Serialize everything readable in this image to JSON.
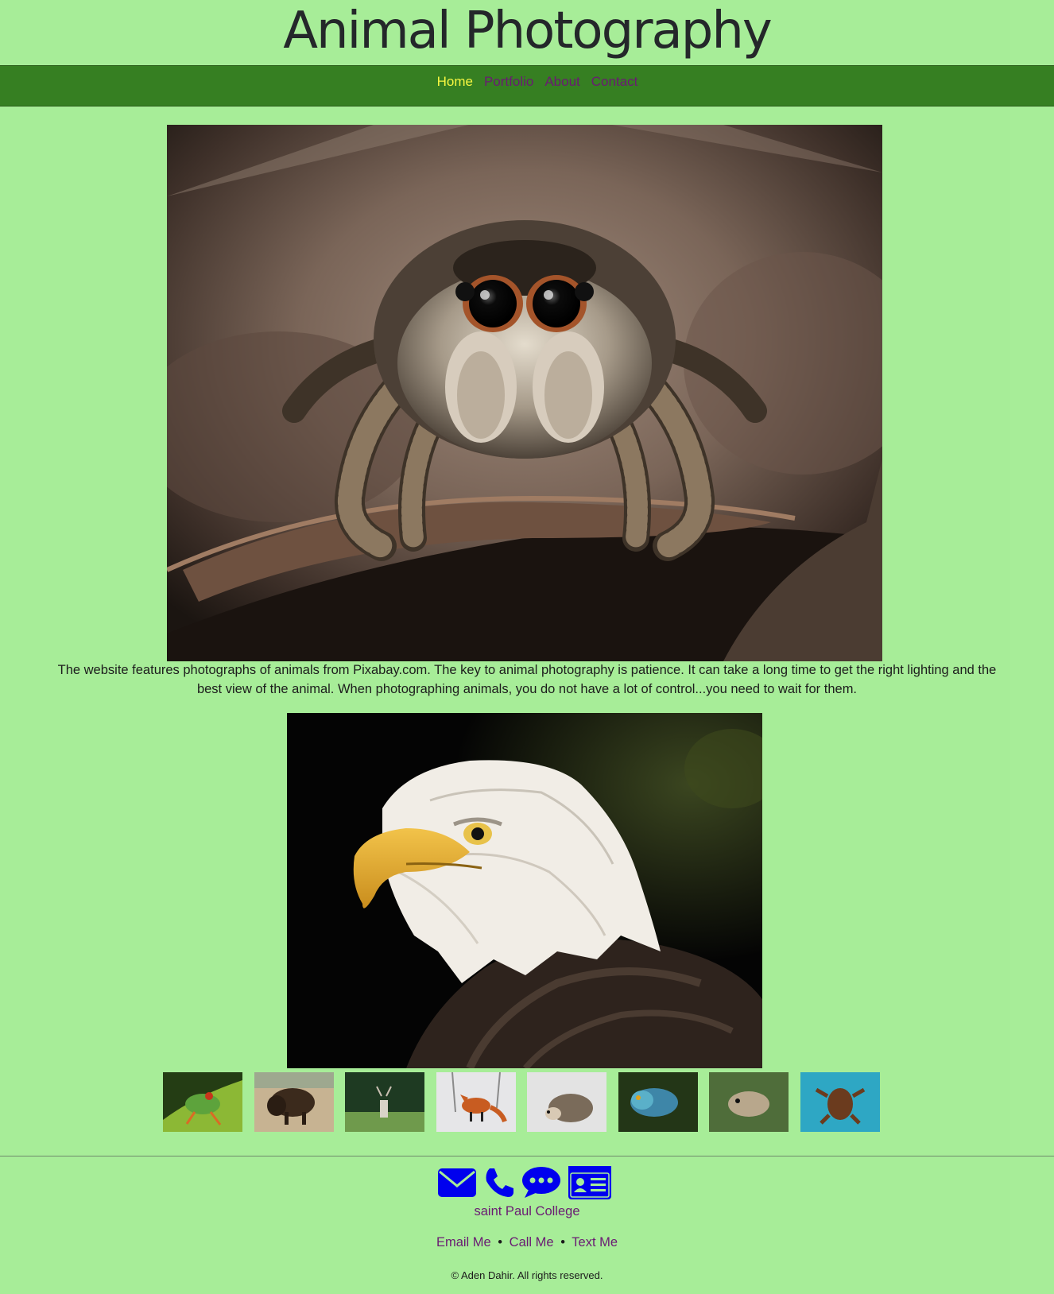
{
  "site": {
    "title": "Animal Photography"
  },
  "nav": {
    "items": [
      {
        "label": "Home",
        "active": true
      },
      {
        "label": "Portfolio",
        "active": false
      },
      {
        "label": "About",
        "active": false
      },
      {
        "label": "Contact",
        "active": false
      }
    ]
  },
  "main": {
    "hero_image": "jumping-spider-photo",
    "intro": "The website features photographs of animals from Pixabay.com. The key to animal photography is patience. It can take a long time to get the right lighting and the best view of the animal. When photographing animals, you do not have a lot of control...you need to wait for them.",
    "feature_image": "bald-eagle-photo",
    "thumbnails": [
      "tree-frog",
      "bison",
      "deer",
      "red-fox",
      "hedgehog",
      "lizard",
      "otter",
      "sea-turtle"
    ]
  },
  "footer": {
    "icons": [
      "envelope-icon",
      "phone-icon",
      "chat-bubble-icon",
      "contact-card-icon"
    ],
    "college": "saint Paul College",
    "links": {
      "email": "Email Me",
      "call": "Call Me",
      "text": "Text Me",
      "separator": "•"
    },
    "copyright": "© Aden Dahir. All rights reserved."
  },
  "colors": {
    "page_bg": "#a7ed98",
    "nav_bg": "#367f22",
    "link": "#6a1b73",
    "active_link": "#f7f741",
    "icon": "#0000ee"
  }
}
